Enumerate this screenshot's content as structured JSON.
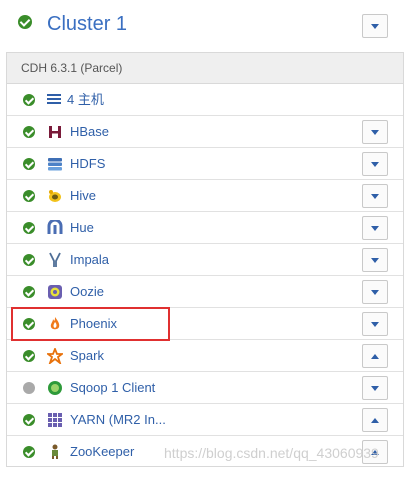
{
  "cluster": {
    "name": "Cluster 1",
    "version": "CDH 6.3.1 (Parcel)"
  },
  "hosts": {
    "label": "4 主机"
  },
  "services": [
    {
      "name": "HBase",
      "status": "ok",
      "icon": "hbase-icon",
      "menu": "down"
    },
    {
      "name": "HDFS",
      "status": "ok",
      "icon": "hdfs-icon",
      "menu": "down"
    },
    {
      "name": "Hive",
      "status": "ok",
      "icon": "hive-icon",
      "menu": "down"
    },
    {
      "name": "Hue",
      "status": "ok",
      "icon": "hue-icon",
      "menu": "down"
    },
    {
      "name": "Impala",
      "status": "ok",
      "icon": "impala-icon",
      "menu": "down"
    },
    {
      "name": "Oozie",
      "status": "ok",
      "icon": "oozie-icon",
      "menu": "down"
    },
    {
      "name": "Phoenix",
      "status": "ok",
      "icon": "phoenix-icon",
      "menu": "down"
    },
    {
      "name": "Spark",
      "status": "ok",
      "icon": "spark-icon",
      "menu": "up"
    },
    {
      "name": "Sqoop 1 Client",
      "status": "na",
      "icon": "sqoop-icon",
      "menu": "down"
    },
    {
      "name": "YARN (MR2 In...",
      "status": "ok",
      "icon": "yarn-icon",
      "menu": "up"
    },
    {
      "name": "ZooKeeper",
      "status": "ok",
      "icon": "zookeeper-icon",
      "menu": "up"
    }
  ],
  "colors": {
    "link": "#2f5fa8",
    "ok": "#3a8d2a",
    "highlight": "#e03030"
  },
  "watermark": "https://blog.csdn.net/qq_43060939"
}
